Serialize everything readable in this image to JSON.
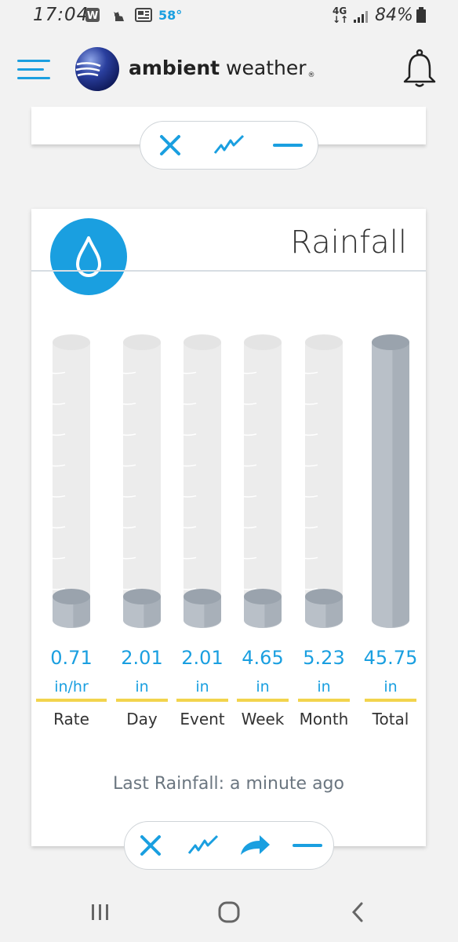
{
  "status_bar": {
    "time": "17:04",
    "temperature": "58°",
    "network": "4G",
    "battery": "84%"
  },
  "app": {
    "logo_bold": "ambient",
    "logo_light": "weather",
    "logo_mark": "®"
  },
  "colors": {
    "accent": "#1a9fe0",
    "underline": "#f2d44d",
    "gauge_fill": "#b9c0c8",
    "gauge_empty": "#ececec"
  },
  "top_toolbar": {
    "buttons": [
      "close-icon",
      "chart-line-icon",
      "minimize-icon"
    ]
  },
  "rainfall": {
    "title": "Rainfall",
    "gauges": [
      {
        "value": "0.71",
        "unit": "in/hr",
        "label": "Rate",
        "fill": 0.05
      },
      {
        "value": "2.01",
        "unit": "in",
        "label": "Day",
        "fill": 0.05
      },
      {
        "value": "2.01",
        "unit": "in",
        "label": "Event",
        "fill": 0.05
      },
      {
        "value": "4.65",
        "unit": "in",
        "label": "Week",
        "fill": 0.05
      },
      {
        "value": "5.23",
        "unit": "in",
        "label": "Month",
        "fill": 0.08
      },
      {
        "value": "45.75",
        "unit": "in",
        "label": "Total",
        "fill": 1.0
      }
    ],
    "last_rainfall": "Last Rainfall: a minute ago"
  },
  "bottom_toolbar": {
    "buttons": [
      "close-icon",
      "chart-line-icon",
      "share-icon",
      "minimize-icon"
    ]
  },
  "nav": {
    "buttons": [
      "recent-apps-icon",
      "home-icon",
      "back-icon"
    ]
  }
}
